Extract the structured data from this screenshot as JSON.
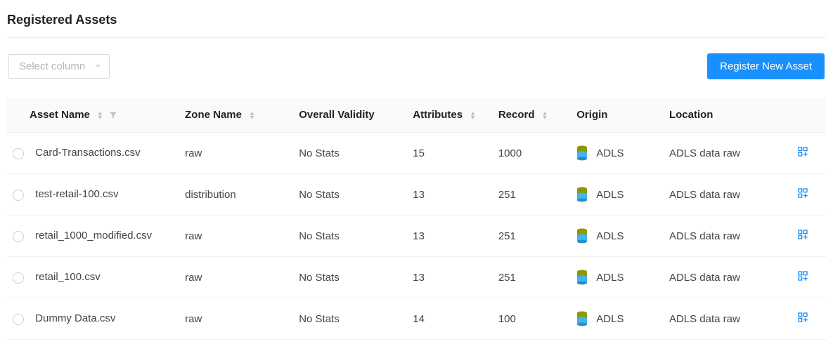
{
  "title": "Registered Assets",
  "select_column_placeholder": "Select column",
  "register_button": "Register New Asset",
  "columns": {
    "asset_name": "Asset Name",
    "zone_name": "Zone Name",
    "overall_validity": "Overall Validity",
    "attributes": "Attributes",
    "record": "Record",
    "origin": "Origin",
    "location": "Location"
  },
  "rows": [
    {
      "asset_name": "Card-Transactions.csv",
      "zone_name": "raw",
      "overall_validity": "No Stats",
      "attributes": "15",
      "record": "1000",
      "origin": "ADLS",
      "location": "ADLS data raw"
    },
    {
      "asset_name": "test-retail-100.csv",
      "zone_name": "distribution",
      "overall_validity": "No Stats",
      "attributes": "13",
      "record": "251",
      "origin": "ADLS",
      "location": "ADLS data raw"
    },
    {
      "asset_name": "retail_1000_modified.csv",
      "zone_name": "raw",
      "overall_validity": "No Stats",
      "attributes": "13",
      "record": "251",
      "origin": "ADLS",
      "location": "ADLS data raw"
    },
    {
      "asset_name": "retail_100.csv",
      "zone_name": "raw",
      "overall_validity": "No Stats",
      "attributes": "13",
      "record": "251",
      "origin": "ADLS",
      "location": "ADLS data raw"
    },
    {
      "asset_name": "Dummy Data.csv",
      "zone_name": "raw",
      "overall_validity": "No Stats",
      "attributes": "14",
      "record": "100",
      "origin": "ADLS",
      "location": "ADLS data raw"
    }
  ]
}
